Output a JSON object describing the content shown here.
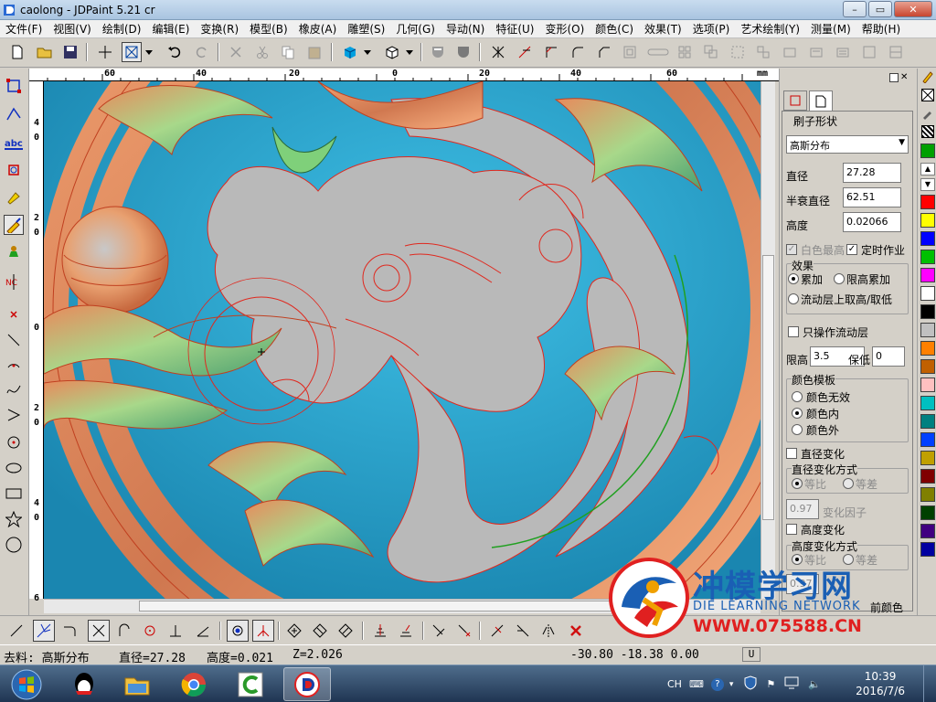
{
  "window": {
    "title": "caolong - JDPaint 5.21 cr",
    "minimize": "–",
    "maximize": "▭",
    "close": "✕"
  },
  "menu": [
    "文件(F)",
    "视图(V)",
    "绘制(D)",
    "编辑(E)",
    "变换(R)",
    "模型(B)",
    "橡皮(A)",
    "雕塑(S)",
    "几何(G)",
    "导动(N)",
    "特征(U)",
    "变形(O)",
    "颜色(C)",
    "效果(T)",
    "选项(P)",
    "艺术绘制(Y)",
    "测量(M)",
    "帮助(H)"
  ],
  "ruler": {
    "top_labels": [
      "60",
      "40",
      "20",
      "0",
      "20",
      "40",
      "60"
    ],
    "unit": "mm",
    "left_labels": [
      "4",
      "0",
      "2",
      "0",
      "0",
      "2",
      "0",
      "4",
      "0",
      "6"
    ]
  },
  "panel": {
    "section_title": "刷子形状",
    "shape_select": "高斯分布",
    "diameter_label": "直径",
    "diameter_value": "27.28",
    "halfdecay_label": "半衰直径",
    "halfdecay_value": "62.51",
    "height_label": "高度",
    "height_value": "0.02066",
    "white_highest": "白色最高",
    "timed_job": "定时作业",
    "effect_group": "效果",
    "effect_add": "累加",
    "effect_limit_add": "限高累加",
    "effect_flow": "流动层上取高/取低",
    "only_flow_layer": "只操作流动层",
    "limit_high_label": "限高",
    "limit_high_value": "3.5",
    "keep_low_label": "保低",
    "keep_low_value": "0",
    "color_template": "颜色模板",
    "color_none": "颜色无效",
    "color_inside": "颜色内",
    "color_outside": "颜色外",
    "diameter_change": "直径变化",
    "diameter_change_mode": "直径变化方式",
    "ratio": "等比",
    "diff": "等差",
    "factor_value": "0.97",
    "factor_label": "变化因子",
    "height_change": "高度变化",
    "height_change_mode": "高度变化方式",
    "ratio2": "等比",
    "diff2": "等差",
    "partial_value": "0.97",
    "front_color": "前颜色"
  },
  "palette": [
    "#00a000",
    "#ff0000",
    "#ffff00",
    "#0000ff",
    "#00c000",
    "#ff00ff",
    "#ffffff",
    "#000000",
    "#c0c0c0",
    "#ff8000",
    "#c06000",
    "#ffc0c0",
    "#00c0c0",
    "#008080",
    "#0040ff",
    "#c0a000",
    "#800000",
    "#808000",
    "#004000",
    "#400080",
    "#0000a0"
  ],
  "status": {
    "material": "去料: 高斯分布",
    "diameter": "直径=27.28",
    "height": "高度=0.021",
    "z": "Z=2.026",
    "coords": "-30.80 -18.38 0.00",
    "mode": "U"
  },
  "taskbar": {
    "ime": "CH",
    "time": "10:39",
    "date": "2016/7/6"
  },
  "watermark": {
    "title": "冲模学习网",
    "subtitle": "DIE LEARNING NETWORK",
    "url": "WWW.075588.CN"
  },
  "colors": {
    "canvas": "#2aa3c9",
    "relief": "#b9b9b9",
    "curve": "#e0281e",
    "accent_orange": "#e8845a",
    "watermark_blue": "#1a5fb4",
    "watermark_red": "#e02020"
  }
}
